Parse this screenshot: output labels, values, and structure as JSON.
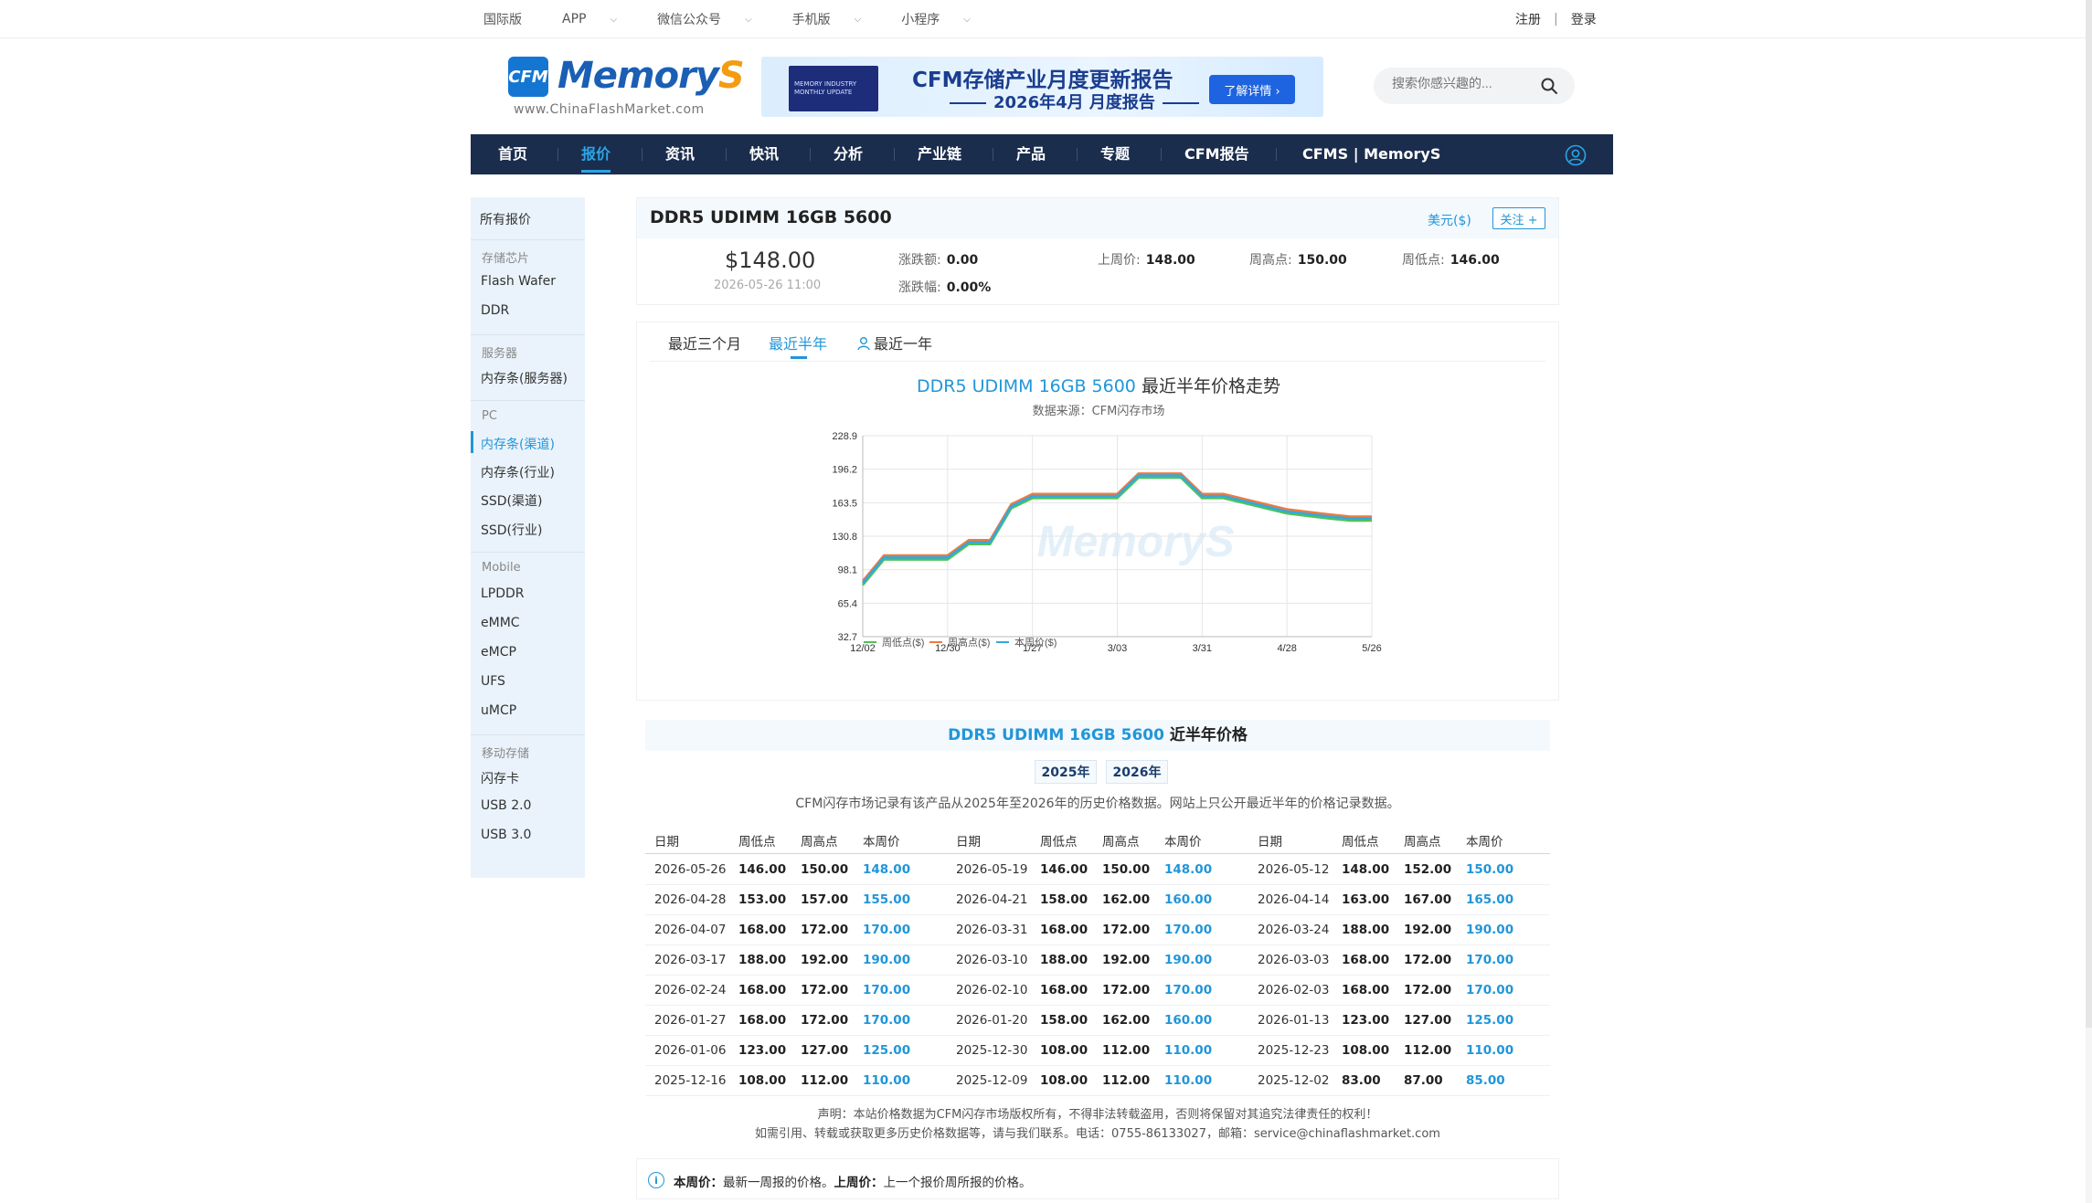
{
  "topbar": {
    "left": [
      "国际版",
      "APP",
      "微信公众号",
      "手机版",
      "小程序"
    ],
    "register": "注册",
    "login": "登录"
  },
  "header": {
    "logo_badge": "CFM",
    "logo_text": "Memory",
    "logo_text_s": "S",
    "logo_url": "www.ChinaFlashMarket.com",
    "banner_title": "CFM存储产业月度更新报告",
    "banner_sub": "2026年4月 月度报告",
    "banner_button": "了解详情 ›",
    "banner_thumb": "MEMORY INDUSTRY MONTHLY UPDATE",
    "search_placeholder": "搜索你感兴趣的..."
  },
  "nav": {
    "items": [
      "首页",
      "报价",
      "资讯",
      "快讯",
      "分析",
      "产业链",
      "产品",
      "专题",
      "CFM报告",
      "CFMS | MemoryS"
    ],
    "active": "报价"
  },
  "sidebar": {
    "all": "所有报价",
    "groups": [
      {
        "label": "存储芯片",
        "items": [
          "Flash Wafer",
          "DDR"
        ]
      },
      {
        "label": "服务器",
        "items": [
          "内存条(服务器)"
        ]
      },
      {
        "label": "PC",
        "items": [
          "内存条(渠道)",
          "内存条(行业)",
          "SSD(渠道)",
          "SSD(行业)"
        ]
      },
      {
        "label": "Mobile",
        "items": [
          "LPDDR",
          "eMMC",
          "eMCP",
          "UFS",
          "uMCP"
        ]
      },
      {
        "label": "移动存储",
        "items": [
          "闪存卡",
          "USB 2.0",
          "USB 3.0"
        ]
      }
    ],
    "active": "内存条(渠道)"
  },
  "product": {
    "title": "DDR5 UDIMM 16GB 5600",
    "currency": "美元($)",
    "follow": "关注 +",
    "price": "$148.00",
    "time": "2026-05-26 11:00",
    "change_label": "涨跌额:",
    "change": "0.00",
    "change_pct_label": "涨跌幅:",
    "change_pct": "0.00%",
    "last_week_label": "上周价:",
    "last_week": "148.00",
    "week_high_label": "周高点:",
    "week_high": "150.00",
    "week_low_label": "周低点:",
    "week_low": "146.00"
  },
  "chart_tabs": [
    "最近三个月",
    "最近半年",
    "最近一年"
  ],
  "chart_tab_active": "最近半年",
  "chart_title_suffix": "最近半年价格走势",
  "chart_source": "数据来源：CFM闪存市场",
  "chart_watermark": "MemoryS",
  "chart_data": {
    "type": "line",
    "title": "DDR5 UDIMM 16GB 5600 最近半年价格走势",
    "subtitle": "数据来源：CFM闪存市场",
    "x": [
      "2025-12-02",
      "2025-12-09",
      "2025-12-16",
      "2025-12-23",
      "2025-12-30",
      "2026-01-06",
      "2026-01-13",
      "2026-01-20",
      "2026-01-27",
      "2026-02-03",
      "2026-02-10",
      "2026-02-24",
      "2026-03-03",
      "2026-03-10",
      "2026-03-17",
      "2026-03-24",
      "2026-03-31",
      "2026-04-07",
      "2026-04-14",
      "2026-04-21",
      "2026-04-28",
      "2026-05-05",
      "2026-05-12",
      "2026-05-19",
      "2026-05-26"
    ],
    "x_tick_labels": [
      "12/02",
      "12/30",
      "1/27",
      "3/03",
      "3/31",
      "4/28",
      "5/26"
    ],
    "y_tick_labels": [
      "32.7",
      "65.4",
      "98.1",
      "130.8",
      "163.5",
      "196.2",
      "228.9"
    ],
    "ylim": [
      32.7,
      228.9
    ],
    "series": [
      {
        "name": "周低点($)",
        "color": "#4cc35a",
        "values": [
          83,
          108,
          108,
          108,
          108,
          123,
          123,
          158,
          168,
          168,
          168,
          168,
          168,
          188,
          188,
          188,
          168,
          168,
          163,
          158,
          153,
          null,
          148,
          146,
          146
        ]
      },
      {
        "name": "周高点($)",
        "color": "#f07a3c",
        "values": [
          87,
          112,
          112,
          112,
          112,
          127,
          127,
          162,
          172,
          172,
          172,
          172,
          172,
          192,
          192,
          192,
          172,
          172,
          167,
          162,
          157,
          null,
          152,
          150,
          150
        ]
      },
      {
        "name": "本周价($)",
        "color": "#35a7e0",
        "values": [
          85,
          110,
          110,
          110,
          110,
          125,
          125,
          160,
          170,
          170,
          170,
          170,
          170,
          190,
          190,
          190,
          170,
          170,
          165,
          160,
          155,
          null,
          150,
          148,
          148
        ]
      }
    ],
    "grid": true,
    "legend": "bottom"
  },
  "table_section": {
    "title_suffix": "近半年价格",
    "years": [
      "2025年",
      "2026年"
    ],
    "note": "CFM闪存市场记录有该产品从2025年至2026年的历史价格数据。网站上只公开最近半年的价格记录数据。",
    "headers": [
      "日期",
      "周低点",
      "周高点",
      "本周价"
    ],
    "rows": [
      [
        "2026-05-26",
        "146.00",
        "150.00",
        "148.00",
        "2026-05-19",
        "146.00",
        "150.00",
        "148.00",
        "2026-05-12",
        "148.00",
        "152.00",
        "150.00"
      ],
      [
        "2026-04-28",
        "153.00",
        "157.00",
        "155.00",
        "2026-04-21",
        "158.00",
        "162.00",
        "160.00",
        "2026-04-14",
        "163.00",
        "167.00",
        "165.00"
      ],
      [
        "2026-04-07",
        "168.00",
        "172.00",
        "170.00",
        "2026-03-31",
        "168.00",
        "172.00",
        "170.00",
        "2026-03-24",
        "188.00",
        "192.00",
        "190.00"
      ],
      [
        "2026-03-17",
        "188.00",
        "192.00",
        "190.00",
        "2026-03-10",
        "188.00",
        "192.00",
        "190.00",
        "2026-03-03",
        "168.00",
        "172.00",
        "170.00"
      ],
      [
        "2026-02-24",
        "168.00",
        "172.00",
        "170.00",
        "2026-02-10",
        "168.00",
        "172.00",
        "170.00",
        "2026-02-03",
        "168.00",
        "172.00",
        "170.00"
      ],
      [
        "2026-01-27",
        "168.00",
        "172.00",
        "170.00",
        "2026-01-20",
        "158.00",
        "162.00",
        "160.00",
        "2026-01-13",
        "123.00",
        "127.00",
        "125.00"
      ],
      [
        "2026-01-06",
        "123.00",
        "127.00",
        "125.00",
        "2025-12-30",
        "108.00",
        "112.00",
        "110.00",
        "2025-12-23",
        "108.00",
        "112.00",
        "110.00"
      ],
      [
        "2025-12-16",
        "108.00",
        "112.00",
        "110.00",
        "2025-12-09",
        "108.00",
        "112.00",
        "110.00",
        "2025-12-02",
        "83.00",
        "87.00",
        "85.00"
      ]
    ],
    "declaration1": "声明：本站价格数据为CFM闪存市场版权所有，不得非法转载盗用，否则将保留对其追究法律责任的权利！",
    "declaration2": "如需引用、转载或获取更多历史价格数据等，请与我们联系。电话：0755-86133027，邮箱：service@chinaflashmarket.com"
  },
  "legend_note": {
    "k1": "本周价：",
    "v1": "最新一周报的价格。",
    "k2": "上周价：",
    "v2": "上一个报价周所报的价格。"
  },
  "colors": {
    "accent": "#2196d9",
    "nav_bg": "#1b2d4d",
    "low": "#4cc35a",
    "high": "#f07a3c",
    "cur": "#35a7e0"
  }
}
